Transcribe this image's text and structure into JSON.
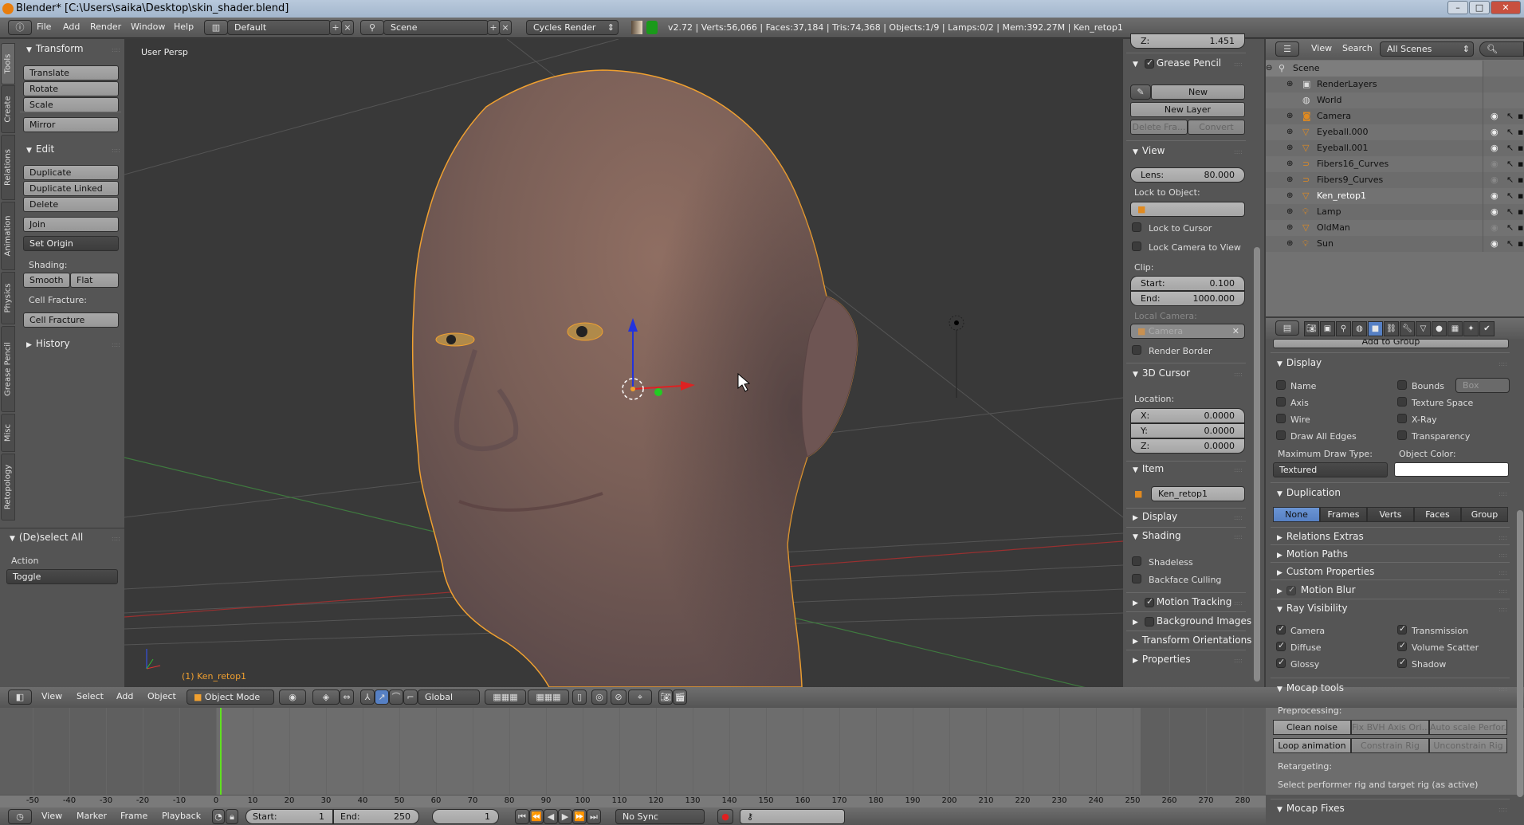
{
  "window": {
    "title": "Blender* [C:\\Users\\saika\\Desktop\\skin_shader.blend]"
  },
  "top_header": {
    "menus": [
      "File",
      "Add",
      "Render",
      "Window",
      "Help"
    ],
    "layout": "Default",
    "scene": "Scene",
    "engine": "Cycles Render",
    "stats": "v2.72 | Verts:56,066 | Faces:37,184 | Tris:74,368 | Objects:1/9 | Lamps:0/2 | Mem:392.27M | Ken_retop1"
  },
  "tool_shelf": {
    "tabs": [
      "Tools",
      "Create",
      "Relations",
      "Animation",
      "Physics",
      "Grease Pencil",
      "Misc",
      "Retopology"
    ],
    "active_tab": "Tools",
    "transform": {
      "title": "Transform",
      "buttons": [
        "Translate",
        "Rotate",
        "Scale"
      ],
      "mirror": "Mirror"
    },
    "edit": {
      "title": "Edit",
      "buttons": [
        "Duplicate",
        "Duplicate Linked",
        "Delete"
      ],
      "join": "Join",
      "set_origin": "Set Origin",
      "shading_label": "Shading:",
      "smooth": "Smooth",
      "flat": "Flat",
      "cell_label": "Cell Fracture:",
      "cell_button": "Cell Fracture"
    },
    "history": "History",
    "operator": {
      "title": "(De)select All",
      "action_label": "Action",
      "action_value": "Toggle"
    }
  },
  "viewport": {
    "view_name": "User Persp",
    "active_object": "(1) Ken_retop1",
    "colors": {
      "selection_outline": "#f0a030",
      "x_axis": "#c0392b",
      "y_axis": "#3a9a3a",
      "z_axis": "#2233dd"
    }
  },
  "n_panel": {
    "top_field": {
      "label": "Z:",
      "value": "1.451"
    },
    "grease_pencil": {
      "title": "Grease Pencil",
      "enabled": true,
      "new": "New",
      "new_layer": "New Layer",
      "delete_frame": "Delete Fra...",
      "convert": "Convert"
    },
    "view": {
      "title": "View",
      "lens_label": "Lens:",
      "lens": "80.000",
      "lock_to_object": "Lock to Object:",
      "lock_to_cursor": "Lock to Cursor",
      "lock_camera": "Lock Camera to View",
      "clip": "Clip:",
      "start_label": "Start:",
      "start": "0.100",
      "end_label": "End:",
      "end": "1000.000",
      "local_camera": "Local Camera:",
      "camera": "Camera",
      "render_border": "Render Border"
    },
    "cursor": {
      "title": "3D Cursor",
      "location": "Location:",
      "x_label": "X:",
      "x": "0.0000",
      "y_label": "Y:",
      "y": "0.0000",
      "z_label": "Z:",
      "z": "0.0000"
    },
    "item": {
      "title": "Item",
      "name": "Ken_retop1"
    },
    "display": "Display",
    "shading": {
      "title": "Shading",
      "shadeless": "Shadeless",
      "backface": "Backface Culling"
    },
    "motion_tracking": {
      "label": "Motion Tracking",
      "checked": true
    },
    "background_images": {
      "label": "Background Images",
      "checked": false
    },
    "transform_orientations": "Transform Orientations",
    "properties": "Properties"
  },
  "outliner": {
    "menus": [
      "View",
      "Search"
    ],
    "filter": "All Scenes",
    "items": [
      {
        "name": "Scene",
        "icon": "scene-icon",
        "level": 0,
        "visible": null
      },
      {
        "name": "RenderLayers",
        "icon": "render-layers-icon",
        "level": 1,
        "visible": null
      },
      {
        "name": "World",
        "icon": "world-icon",
        "level": 1,
        "visible": null
      },
      {
        "name": "Camera",
        "icon": "camera-icon",
        "level": 1,
        "visible": true
      },
      {
        "name": "Eyeball.000",
        "icon": "mesh-icon",
        "level": 1,
        "visible": true
      },
      {
        "name": "Eyeball.001",
        "icon": "mesh-icon",
        "level": 1,
        "visible": true
      },
      {
        "name": "Fibers16_Curves",
        "icon": "curve-icon",
        "level": 1,
        "visible": false
      },
      {
        "name": "Fibers9_Curves",
        "icon": "curve-icon",
        "level": 1,
        "visible": false
      },
      {
        "name": "Ken_retop1",
        "icon": "mesh-icon",
        "level": 1,
        "visible": true,
        "active": true
      },
      {
        "name": "Lamp",
        "icon": "lamp-icon",
        "level": 1,
        "visible": true
      },
      {
        "name": "OldMan",
        "icon": "mesh-icon",
        "level": 1,
        "visible": false
      },
      {
        "name": "Sun",
        "icon": "lamp-icon",
        "level": 1,
        "visible": true
      }
    ]
  },
  "properties": {
    "tabs": [
      "render",
      "render-layers",
      "scene",
      "world",
      "object",
      "constraints",
      "modifiers",
      "data",
      "material",
      "texture",
      "particles",
      "physics"
    ],
    "active_tab": "object",
    "add_to_group": "Add to Group",
    "display": {
      "title": "Display",
      "left": [
        "Name",
        "Axis",
        "Wire",
        "Draw All Edges"
      ],
      "right": [
        "Bounds",
        "Texture Space",
        "X-Ray",
        "Transparency"
      ],
      "bounds_type": "Box",
      "max_draw_label": "Maximum Draw Type:",
      "max_draw": "Textured",
      "color_label": "Object Color:",
      "object_color": "#ffffff"
    },
    "duplication": {
      "title": "Duplication",
      "options": [
        "None",
        "Frames",
        "Verts",
        "Faces",
        "Group"
      ],
      "selected": "None"
    },
    "collapsed": [
      "Relations Extras",
      "Motion Paths",
      "Custom Properties"
    ],
    "motion_blur": {
      "label": "Motion Blur",
      "checked": true
    },
    "ray_visibility": {
      "title": "Ray Visibility",
      "left": [
        "Camera",
        "Diffuse",
        "Glossy"
      ],
      "right": [
        "Transmission",
        "Volume Scatter",
        "Shadow"
      ]
    },
    "mocap": {
      "title": "Mocap tools",
      "preprocessing": "Preprocessing:",
      "row1": [
        "Clean noise",
        "Fix BVH Axis Ori...",
        "Auto scale Perfor..."
      ],
      "row2": [
        "Loop animation",
        "Constrain Rig",
        "Unconstrain Rig"
      ],
      "retargeting": "Retargeting:",
      "hint": "Select performer rig and target rig (as active)"
    },
    "mocap_fixes": "Mocap Fixes"
  },
  "view3d_header": {
    "menus": [
      "View",
      "Select",
      "Add",
      "Object"
    ],
    "mode": "Object Mode",
    "orientation": "Global"
  },
  "timeline": {
    "ticks": [
      -50,
      -40,
      -30,
      -20,
      -10,
      0,
      10,
      20,
      30,
      40,
      50,
      60,
      70,
      80,
      90,
      100,
      110,
      120,
      130,
      140,
      150,
      160,
      170,
      180,
      190,
      200,
      210,
      220,
      230,
      240,
      250,
      260,
      270,
      280
    ],
    "current_frame": 1,
    "menus": [
      "View",
      "Marker",
      "Frame",
      "Playback"
    ],
    "start_label": "Start:",
    "start": "1",
    "end_label": "End:",
    "end": "250",
    "frame": "1",
    "sync": "No Sync"
  }
}
